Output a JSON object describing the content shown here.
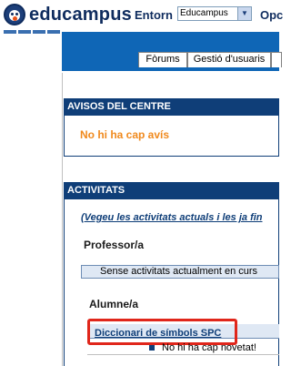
{
  "brand": {
    "name": "educampus",
    "logo_icon": "owl-logo-icon"
  },
  "top_nav": {
    "entorn_label": "Entorn",
    "select_value": "Educampus",
    "more_label": "Opc"
  },
  "tabs": [
    {
      "label": "Fòrums"
    },
    {
      "label": "Gestió d'usuaris"
    }
  ],
  "avisos": {
    "heading": "AVISOS DEL CENTRE",
    "empty_text": "No hi ha cap avís"
  },
  "activitats": {
    "heading": "ACTIVITATS",
    "link_text": "(Vegeu les activitats actuals i les ja fin",
    "teacher_role": "Professor/a",
    "teacher_empty": "Sense activitats actualment en curs",
    "student_role": "Alumne/a",
    "course_link": "Diccionari de símbols SPC",
    "news_text": "No hi ha cap novetat!"
  },
  "colors": {
    "brand": "#0f2c5e",
    "header_blue": "#0f66b6",
    "section_blue": "#0f3e78",
    "notice_orange": "#f08a1e",
    "highlight_red": "#e0261b"
  }
}
